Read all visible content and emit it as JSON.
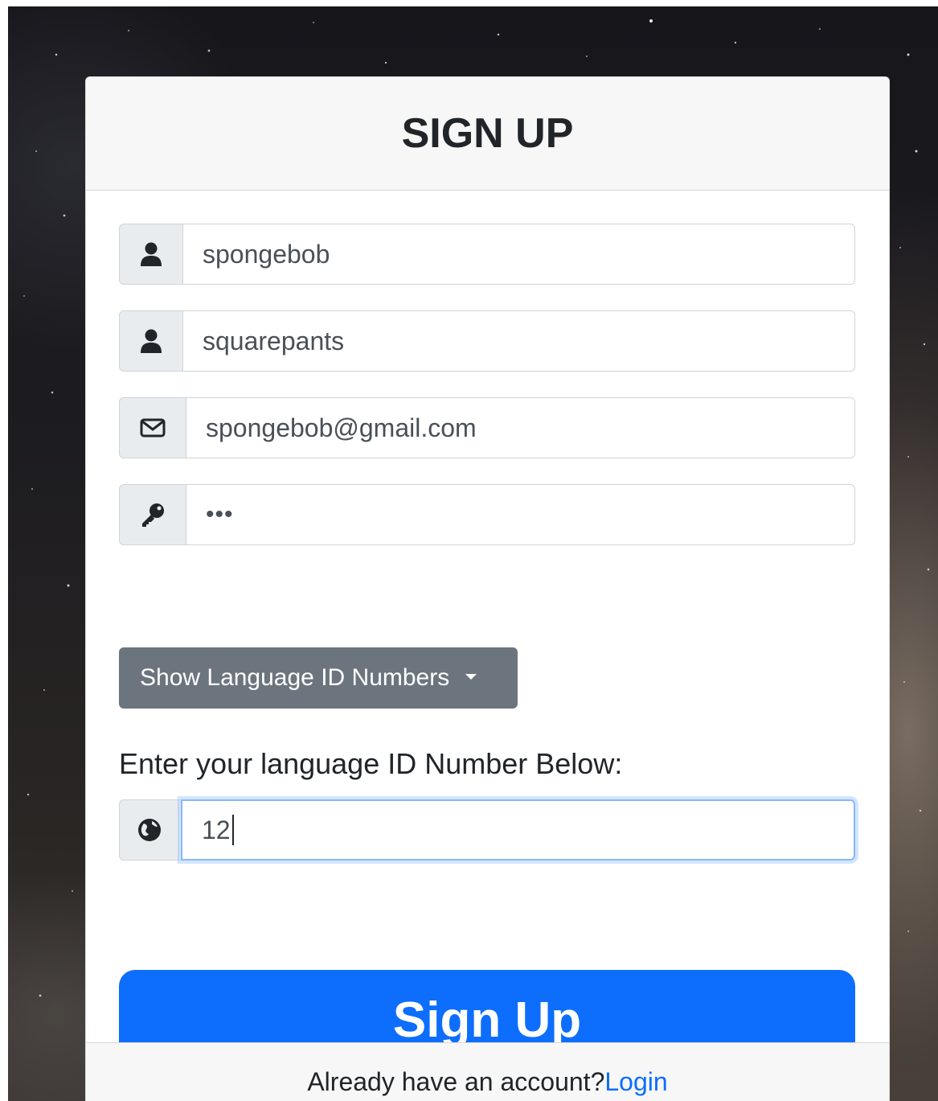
{
  "form": {
    "title": "SIGN UP",
    "first_name_value": "spongebob",
    "last_name_value": "squarepants",
    "email_value": "spongebob@gmail.com",
    "password_mask": "•••",
    "language_dropdown_label": "Show Language ID Numbers",
    "language_label": "Enter your language ID Number Below:",
    "language_value": "12",
    "submit_label": "Sign Up"
  },
  "footer": {
    "prompt": "Already have an account?",
    "login_link": "Login"
  },
  "colors": {
    "primary": "#0d6efd",
    "secondary": "#6c757d",
    "addon_bg": "#e9ecef",
    "header_bg": "#f7f7f7"
  },
  "icons": [
    "user-icon",
    "user-icon",
    "envelope-icon",
    "key-icon",
    "caret-down-icon",
    "globe-icon"
  ]
}
